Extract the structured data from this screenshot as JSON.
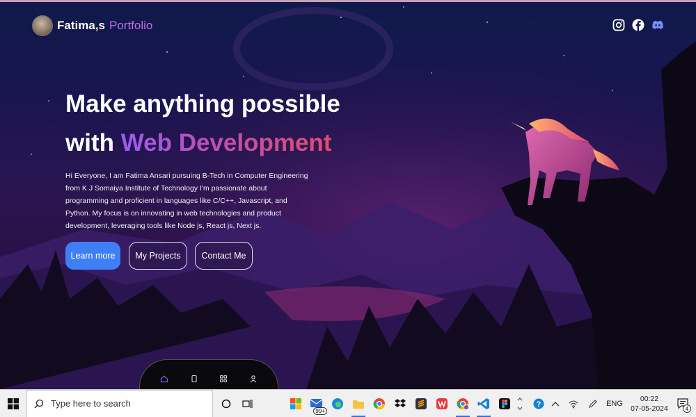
{
  "site": {
    "logo_name": "Fatima,s",
    "logo_accent": "Portfolio",
    "social_icons": [
      "instagram-icon",
      "facebook-icon",
      "discord-icon"
    ]
  },
  "hero": {
    "headline_line1": "Make anything possible",
    "headline_with": "with",
    "headline_highlight": "Web Development",
    "intro": "Hi Everyone, I am Fatima Ansari pursuing B-Tech in Computer Engineering from K J Somaiya Institute of Technology I'm passionate about programming and proficient in languages like C/C++, Javascript, and Python. My focus is on innovating in web technologies and product development, leveraging tools like Node js, React js, Next js.",
    "buttons": {
      "learn_more": "Learn more",
      "projects": "My Projects",
      "contact": "Contact Me"
    }
  },
  "bottom_nav": {
    "icons": [
      "home-icon",
      "document-icon",
      "grid-icon",
      "user-icon"
    ],
    "active": "home-icon"
  },
  "colors": {
    "accent_purple": "#c26be2",
    "button_blue": "#3f7ff5",
    "gradient_start": "#9b5cf0",
    "gradient_end": "#e04e6a"
  },
  "taskbar": {
    "search_placeholder": "Type here to search",
    "mail_badge": "99+",
    "language": "ENG",
    "time": "00:22",
    "date": "07-05-2024",
    "notification_count": "4",
    "app_icons": [
      "task-view-icon",
      "widgets-icon",
      "file-explorer-icon",
      "mail-icon",
      "edge-icon",
      "folder-icon",
      "chrome-icon",
      "dropbox-icon",
      "sublime-icon",
      "wps-office-icon",
      "chrome-profile-icon",
      "vscode-icon",
      "figma-icon"
    ],
    "tray_icons": [
      "help-icon",
      "chevron-up-icon",
      "wifi-icon",
      "pen-icon"
    ]
  }
}
